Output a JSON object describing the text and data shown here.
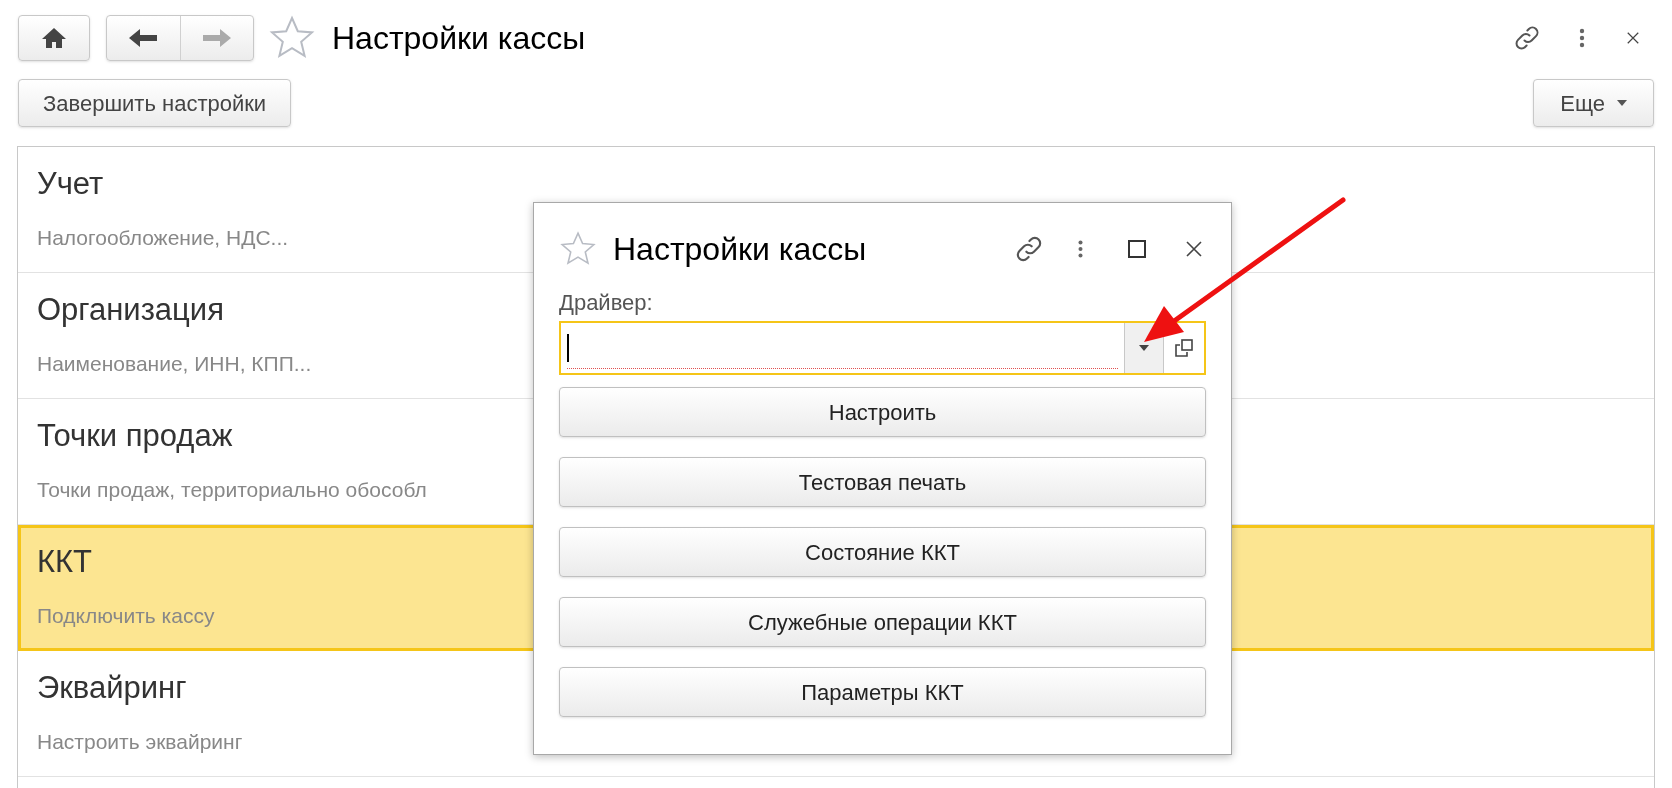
{
  "window": {
    "title": "Настройки кассы",
    "forward_disabled": true
  },
  "toolbar": {
    "buttons": [
      "Завершить настройки"
    ],
    "more": "Еще"
  },
  "sections": [
    {
      "title": "Учет",
      "subtitle": "Налогообложение, НДС...",
      "selected": false
    },
    {
      "title": "Организация",
      "subtitle": "Наименование, ИНН, КПП...",
      "selected": false
    },
    {
      "title": "Точки продаж",
      "subtitle": "Точки продаж, территориально обособл",
      "selected": false
    },
    {
      "title": "ККТ",
      "subtitle": "Подключить кассу",
      "selected": true
    },
    {
      "title": "Эквайринг",
      "subtitle": "Настроить эквайринг",
      "selected": false
    }
  ],
  "dialog": {
    "title": "Настройки кассы",
    "field": {
      "label": "Драйвер:",
      "focused": true
    },
    "buttons": [
      "Настроить",
      "Тестовая печать",
      "Состояние ККТ",
      "Служебные операции ККТ",
      "Параметры ККТ"
    ]
  }
}
